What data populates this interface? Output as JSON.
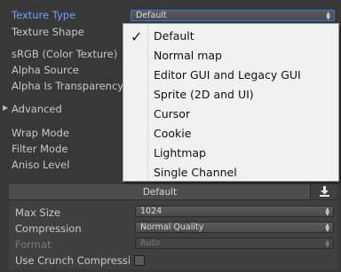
{
  "inspector": {
    "texture_type": {
      "label": "Texture Type",
      "value": "Default"
    },
    "texture_shape": {
      "label": "Texture Shape"
    },
    "srgb": {
      "label": "sRGB (Color Texture)"
    },
    "alpha_source": {
      "label": "Alpha Source"
    },
    "alpha_is_transparency": {
      "label": "Alpha Is Transparency"
    },
    "advanced": {
      "label": "Advanced"
    },
    "wrap_mode": {
      "label": "Wrap Mode"
    },
    "filter_mode": {
      "label": "Filter Mode"
    },
    "aniso_level": {
      "label": "Aniso Level"
    }
  },
  "dropdown_menu": {
    "items": [
      {
        "label": "Default",
        "checked": true
      },
      {
        "label": "Normal map"
      },
      {
        "label": "Editor GUI and Legacy GUI"
      },
      {
        "label": "Sprite (2D and UI)"
      },
      {
        "label": "Cursor"
      },
      {
        "label": "Cookie"
      },
      {
        "label": "Lightmap"
      },
      {
        "label": "Single Channel"
      }
    ]
  },
  "platform_section": {
    "tab_label": "Default",
    "download_icon": "download-icon",
    "max_size": {
      "label": "Max Size",
      "value": "1024"
    },
    "compression": {
      "label": "Compression",
      "value": "Normal Quality"
    },
    "format": {
      "label": "Format",
      "value": "Auto"
    },
    "use_crunch": {
      "label": "Use Crunch Compressi",
      "checked": false
    }
  },
  "colors": {
    "background": "#383838",
    "active_label": "#6fa3ff",
    "menu_background": "#f1f1f1"
  }
}
